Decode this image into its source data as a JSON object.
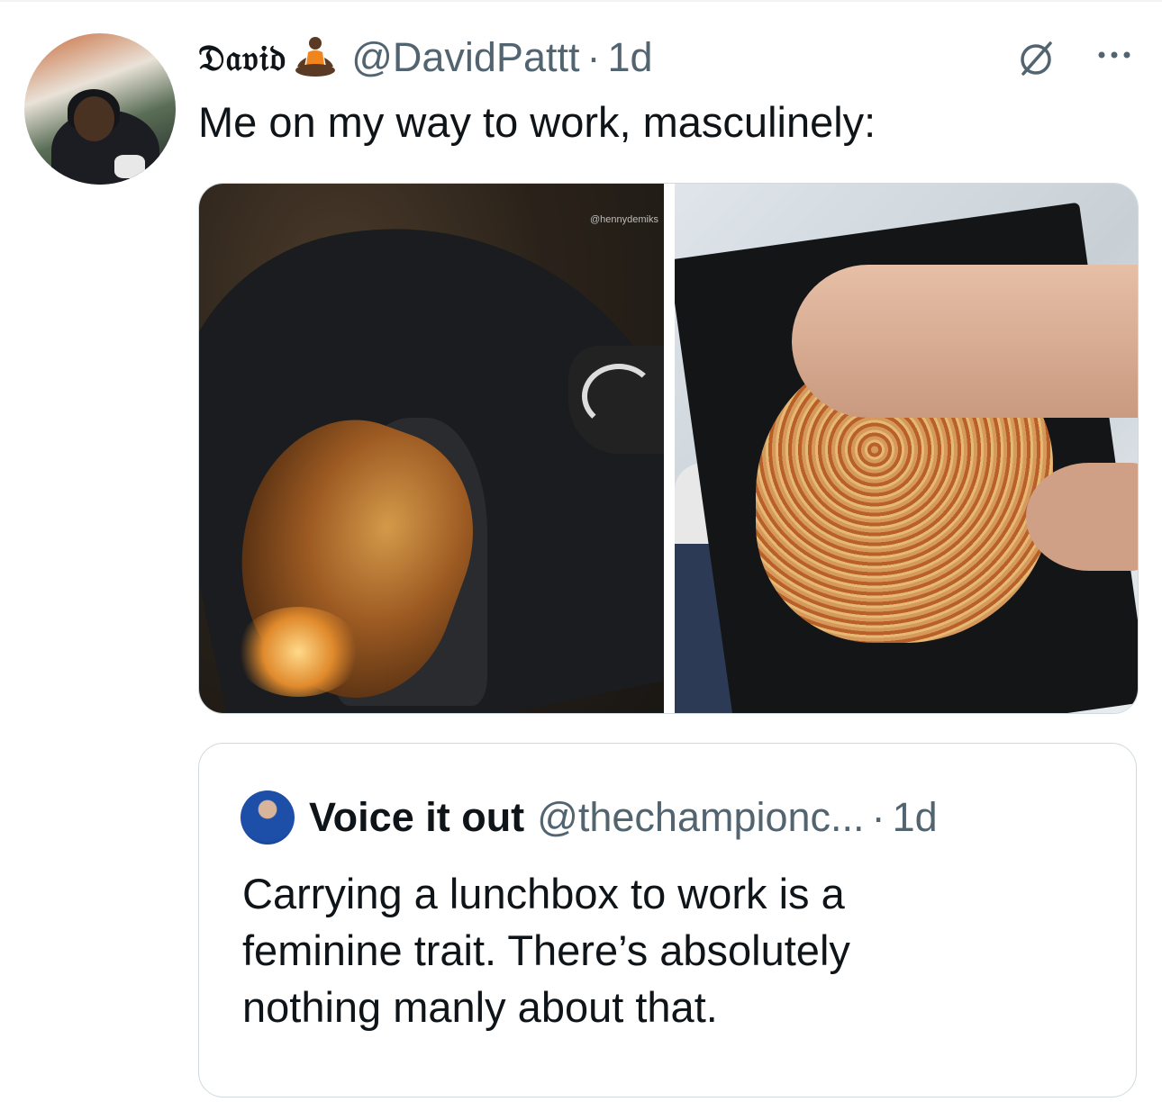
{
  "tweet": {
    "author_name": "𝔇𝔞𝔳𝔦𝔡",
    "handle": "@DavidPattt",
    "separator": "·",
    "time": "1d",
    "text": "Me on my way to work, masculinely:",
    "watermark": "@hennydemiks",
    "icons": {
      "author_emoji": "meditation-emoji",
      "grok": "grok-icon",
      "more": "more-icon"
    }
  },
  "quote": {
    "author_name": "Voice it out",
    "handle": "@thechampionc...",
    "separator": "·",
    "time": "1d",
    "text_lines": [
      "Carrying a lunchbox to work is a",
      "feminine trait. There’s absolutely",
      "nothing manly about that."
    ]
  },
  "colors": {
    "text": "#0f1419",
    "secondary": "#536471",
    "border": "#cfd9de"
  }
}
